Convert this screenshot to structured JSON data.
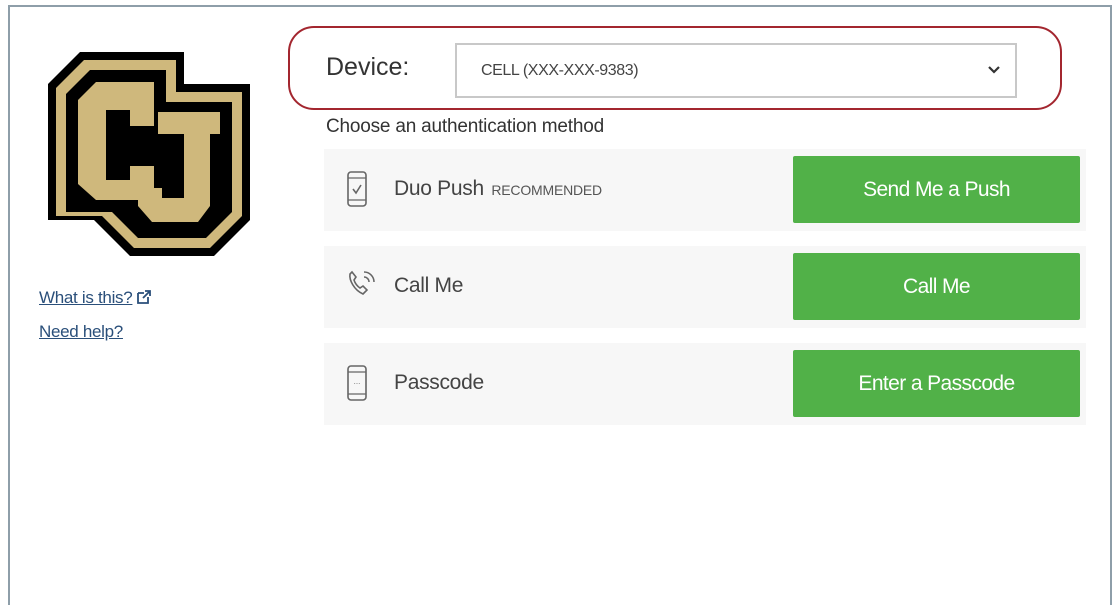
{
  "sidebar": {
    "what_is_this": "What is this?",
    "need_help": "Need help?"
  },
  "device": {
    "label": "Device:",
    "selected": "CELL (XXX-XXX-9383)"
  },
  "choose_label": "Choose an authentication method",
  "methods": [
    {
      "name": "Duo Push",
      "tag": "RECOMMENDED",
      "button": "Send Me a Push",
      "icon": "phone-check-icon"
    },
    {
      "name": "Call Me",
      "tag": "",
      "button": "Call Me",
      "icon": "phone-call-icon"
    },
    {
      "name": "Passcode",
      "tag": "",
      "button": "Enter a Passcode",
      "icon": "phone-passcode-icon"
    }
  ],
  "colors": {
    "button_green": "#51b148",
    "highlight_ring": "#a3262f",
    "logo_gold": "#cfb87c",
    "link_blue": "#2a4f7a"
  }
}
